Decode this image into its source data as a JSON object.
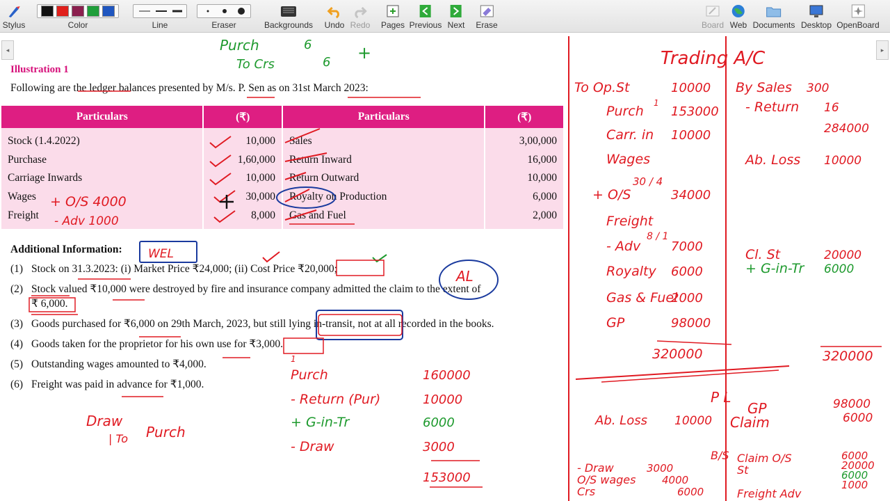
{
  "toolbar": {
    "left": [
      {
        "label": "Stylus",
        "icon": "stylus-icon"
      },
      {
        "label": "Color",
        "icon": "color-palette-icon"
      },
      {
        "label": "Line",
        "icon": "line-width-icon"
      },
      {
        "label": "Eraser",
        "icon": "eraser-size-icon"
      },
      {
        "label": "Backgrounds",
        "icon": "backgrounds-icon"
      },
      {
        "label": "Undo",
        "icon": "undo-icon"
      },
      {
        "label": "Redo",
        "icon": "redo-icon"
      },
      {
        "label": "Pages",
        "icon": "pages-icon"
      },
      {
        "label": "Previous",
        "icon": "previous-icon"
      },
      {
        "label": "Next",
        "icon": "next-icon"
      },
      {
        "label": "Erase",
        "icon": "erase-icon"
      }
    ],
    "right": [
      {
        "label": "Board",
        "icon": "board-icon"
      },
      {
        "label": "Web",
        "icon": "web-globe-icon"
      },
      {
        "label": "Documents",
        "icon": "documents-folder-icon"
      },
      {
        "label": "Desktop",
        "icon": "desktop-icon"
      },
      {
        "label": "OpenBoard",
        "icon": "openboard-icon"
      }
    ],
    "colors": [
      "#111111",
      "#e0201c",
      "#8b1f4e",
      "#1f9e3a",
      "#1f56c0"
    ]
  },
  "slide": {
    "title": "Illustration 1",
    "intro": "Following are the ledger balances presented by M/s. P. Sen as on 31st March 2023:",
    "table": {
      "headers": [
        "Particulars",
        "(₹)",
        "Particulars",
        "(₹)"
      ],
      "rows": [
        [
          "Stock (1.4.2022)",
          "10,000",
          "Sales",
          "3,00,000"
        ],
        [
          "Purchase",
          "1,60,000",
          "Return Inward",
          "16,000"
        ],
        [
          "Carriage Inwards",
          "10,000",
          "Return Outward",
          "10,000"
        ],
        [
          "Wages",
          "30,000",
          "Royalty on Production",
          "6,000"
        ],
        [
          "Freight",
          "8,000",
          "Gas and Fuel",
          "2,000"
        ]
      ]
    },
    "additional_title": "Additional Information:",
    "additional": [
      {
        "n": "(1)",
        "text": "Stock on 31.3.2023: (i) Market Price ₹24,000; (ii) Cost Price ₹20,000;"
      },
      {
        "n": "(2)",
        "text": "Stock valued ₹10,000 were destroyed by fire and insurance company admitted the claim to the extent of"
      },
      {
        "n": "",
        "text": "₹ 6,000."
      },
      {
        "n": "(3)",
        "text": "Goods purchased for ₹6,000 on 29th March, 2023, but still lying in-transit, not at all recorded in the books."
      },
      {
        "n": "(4)",
        "text": "Goods taken for the proprietor for his own use for ₹3,000."
      },
      {
        "n": "(5)",
        "text": "Outstanding wages amounted to ₹4,000."
      },
      {
        "n": "(6)",
        "text": "Freight was paid in advance for ₹1,000."
      }
    ]
  },
  "handwriting": {
    "top_purch": "Purch",
    "top_6a": "6",
    "top_to_crs": "To Crs",
    "top_6b": "6",
    "top_plus": "+",
    "wages_note": "+ O/S   4000",
    "freight_note": "- Adv   1000",
    "web": "WEL",
    "al": "AL",
    "draw_left": "Draw",
    "to_purch": "To Purch",
    "purch_calc": [
      {
        "label": "Purch",
        "value": "160000"
      },
      {
        "label": "- Return (Pur)",
        "value": "10000"
      },
      {
        "label": "+ G-in-Tr",
        "value": "6000"
      },
      {
        "label": "- Draw",
        "value": "3000"
      },
      {
        "label": "",
        "value": "153000"
      }
    ],
    "trading_title": "Trading A/C",
    "trading_left": [
      {
        "label": "To Op.St",
        "value": "10000"
      },
      {
        "label": "Purch",
        "value": "153000"
      },
      {
        "label": "Carr. in",
        "value": "10000"
      },
      {
        "label": "Wages",
        "value": ""
      },
      {
        "label": "+ O/S",
        "value": "34000"
      },
      {
        "label": "Freight",
        "value": ""
      },
      {
        "label": "- Adv",
        "value": "7000"
      },
      {
        "label": "Royalty",
        "value": "6000"
      },
      {
        "label": "Gas & Fuel",
        "value": "2000"
      },
      {
        "label": "GP",
        "value": "98000"
      }
    ],
    "trading_left_total": "320000",
    "wages_fraction": "30 / 4",
    "freight_fraction": "8 / 1",
    "circle_one": "1",
    "trading_right": [
      {
        "label": "By Sales",
        "value": "300"
      },
      {
        "label": "- Return",
        "value": "16"
      },
      {
        "label": "",
        "value": "284000"
      },
      {
        "label": "Ab. Loss",
        "value": "10000"
      },
      {
        "label": "Cl. St",
        "value": "20000"
      },
      {
        "label": "+ G-in-Tr",
        "value": "6000"
      }
    ],
    "trading_right_total": "320000",
    "pl_title": "P L",
    "pl_left": [
      {
        "label": "Ab. Loss",
        "value": "10000"
      }
    ],
    "pl_right": [
      {
        "label": "GP",
        "value": "98000"
      },
      {
        "label": "Claim",
        "value": "6000"
      }
    ],
    "bs_title": "B/S",
    "bs_left": [
      {
        "label": "- Draw",
        "value": "3000"
      },
      {
        "label": "O/S wages",
        "value": "4000"
      },
      {
        "label": "Crs",
        "value": "6000"
      }
    ],
    "bs_right": [
      {
        "label": "Claim O/S",
        "value": "6000"
      },
      {
        "label": "St",
        "value": "20000"
      },
      {
        "label": "",
        "value": "6000"
      },
      {
        "label": "Freight Adv",
        "value": "1000"
      }
    ]
  }
}
